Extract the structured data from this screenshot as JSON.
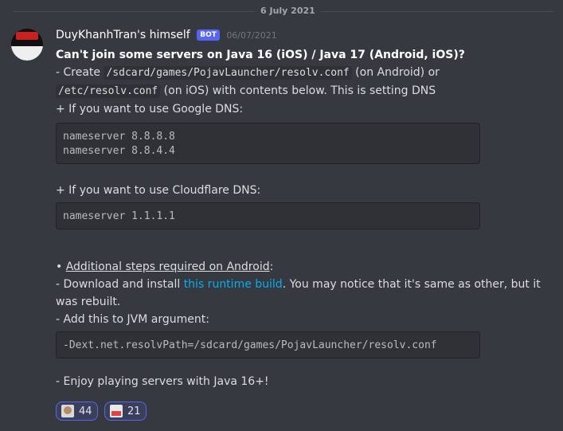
{
  "date_divider": "6 July 2021",
  "message": {
    "author": "DuyKhanhTran's himself",
    "bot_tag": "BOT",
    "timestamp": "06/07/2021",
    "title": "Can't join some servers on Java 16 (iOS) / Java 17 (Android, iOS)?",
    "create_prefix": "- Create ",
    "path_android": "/sdcard/games/PojavLauncher/resolv.conf",
    "on_android_or": " (on Android) or",
    "path_ios": "/etc/resolv.conf",
    "on_ios_text": " (on iOS) with contents below. This is setting DNS",
    "google_dns_label": " + If you want to use Google DNS:",
    "google_dns_lines": "nameserver 8.8.8.8\nnameserver 8.8.4.4",
    "cloudflare_label": " + If you want to use Cloudflare DNS:",
    "cloudflare_lines": "nameserver 1.1.1.1",
    "bullet": "• ",
    "additional_steps": "Additional steps required on Android",
    "colon": ":",
    "download_prefix": "- Download and install ",
    "runtime_link": "this runtime build",
    "download_suffix": ". You may notice that it's same as other, but it",
    "was_rebuilt": "was rebuilt.",
    "jvm_label": "- Add this to JVM argument:",
    "jvm_arg": "-Dext.net.resolvPath=/sdcard/games/PojavLauncher/resolv.conf",
    "enjoy": "- Enjoy playing servers with Java 16+!"
  },
  "reactions": [
    {
      "emoji": "custom-face-emoji",
      "count": "44"
    },
    {
      "emoji": "custom-no-emoji",
      "count": "21"
    }
  ],
  "colors": {
    "background": "#36393f",
    "bot_tag": "#5865f2",
    "link": "#00aff4",
    "reaction_border": "#5865f2"
  }
}
